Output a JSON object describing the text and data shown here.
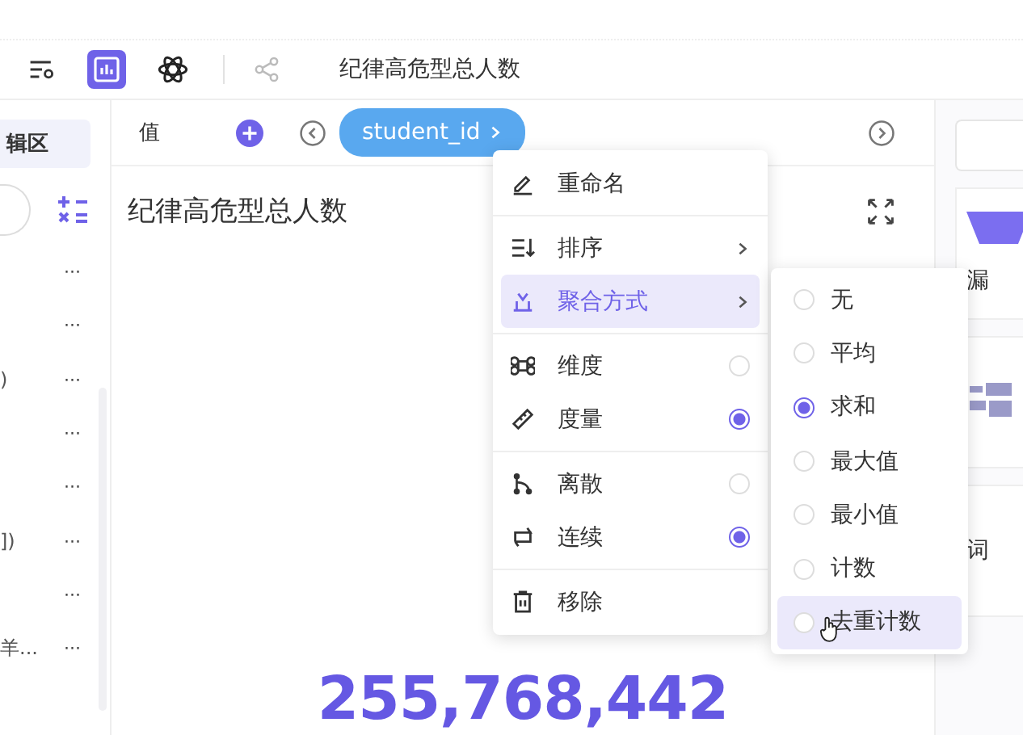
{
  "toolbar": {
    "title": "纪律高危型总人数"
  },
  "sidebar": {
    "header": "辑区",
    "items": [
      {
        "more": "···"
      },
      {
        "more": "···"
      },
      {
        "label": ")",
        "more": "···"
      },
      {
        "more": "···"
      },
      {
        "more": "···"
      },
      {
        "label": "])",
        "more": "···"
      },
      {
        "more": "···"
      },
      {
        "label": "羊...",
        "more": "···"
      }
    ]
  },
  "field_bar": {
    "label": "值",
    "pill": "student_id"
  },
  "chart": {
    "title": "纪律高危型总人数",
    "value": "255,768,442"
  },
  "context_menu": {
    "groups": [
      [
        {
          "label": "重命名",
          "kind": "action",
          "highlighted": false
        }
      ],
      [
        {
          "label": "排序",
          "kind": "submenu",
          "highlighted": false
        },
        {
          "label": "聚合方式",
          "kind": "submenu",
          "highlighted": true
        }
      ],
      [
        {
          "label": "维度",
          "kind": "radio",
          "selected": false,
          "highlighted": false
        },
        {
          "label": "度量",
          "kind": "radio",
          "selected": true,
          "highlighted": false
        }
      ],
      [
        {
          "label": "离散",
          "kind": "radio",
          "selected": false,
          "highlighted": false
        },
        {
          "label": "连续",
          "kind": "radio",
          "selected": true,
          "highlighted": false
        }
      ],
      [
        {
          "label": "移除",
          "kind": "action",
          "highlighted": false
        }
      ]
    ]
  },
  "submenu": {
    "options": [
      {
        "label": "无",
        "selected": false,
        "highlighted": false
      },
      {
        "label": "平均",
        "selected": false,
        "highlighted": false
      },
      {
        "label": "求和",
        "selected": true,
        "highlighted": false
      },
      {
        "label": "最大值",
        "selected": false,
        "highlighted": false
      },
      {
        "label": "最小值",
        "selected": false,
        "highlighted": false
      },
      {
        "label": "计数",
        "selected": false,
        "highlighted": false
      },
      {
        "label": "去重计数",
        "selected": false,
        "highlighted": true
      }
    ]
  },
  "right_panel": {
    "items": [
      {
        "label": "漏"
      },
      {
        "label": "词"
      }
    ]
  }
}
